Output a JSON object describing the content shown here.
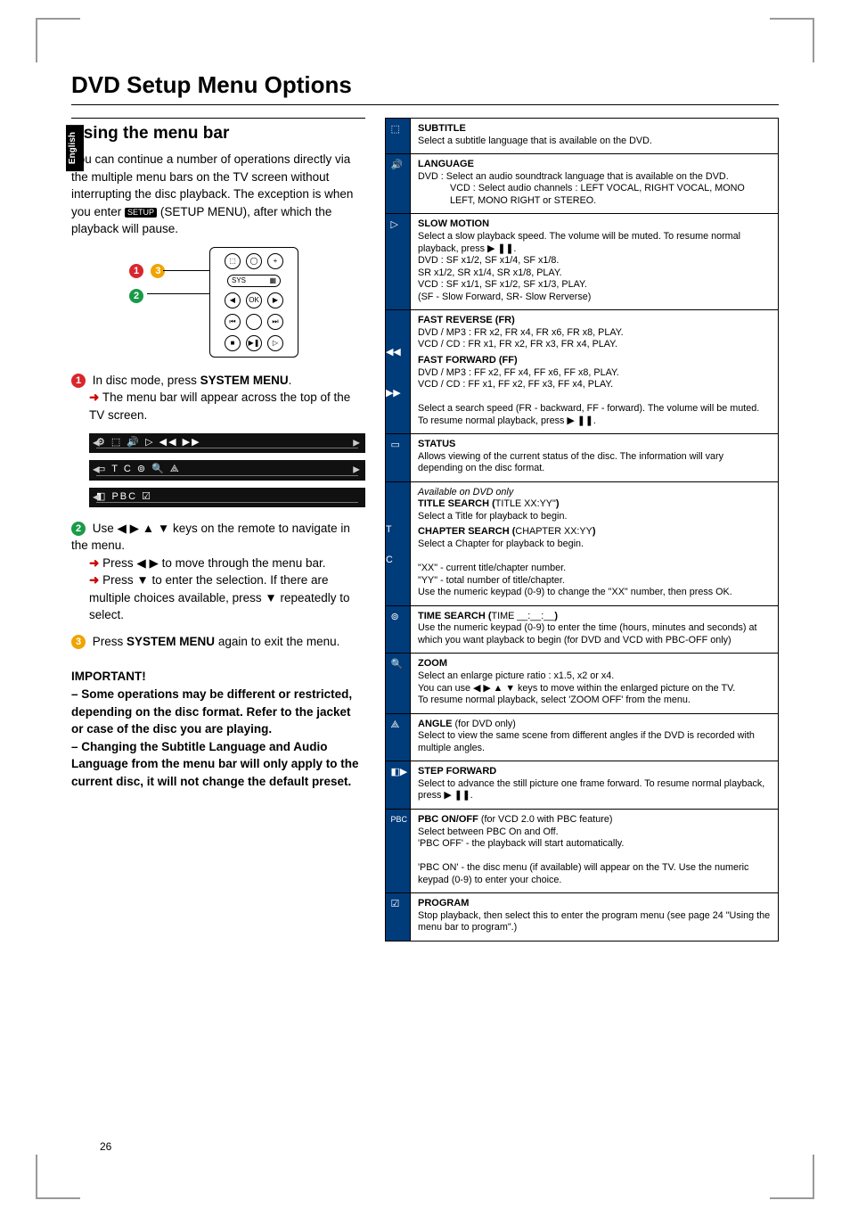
{
  "page": {
    "number": "26",
    "language_tab": "English",
    "title": "DVD Setup Menu Options"
  },
  "left": {
    "section_title": "Using the menu bar",
    "intro_a": "You can continue a number of operations directly via the multiple menu bars on the TV screen without interrupting the disc playback.  The exception is when you enter ",
    "intro_chip": "SETUP",
    "intro_b": " (SETUP MENU), after which the playback will pause.",
    "remote_callouts": {
      "left_top": "1",
      "left_top2": "3",
      "left_mid": "2"
    },
    "steps": [
      {
        "badge": "1",
        "badge_class": "num-1",
        "text_a": "In disc mode, press ",
        "strong_a": "SYSTEM MENU",
        "text_b": ".",
        "sub": "The menu bar will appear across the top of the TV screen."
      },
      {
        "badge": "2",
        "badge_class": "num-2",
        "text_a": "Use ◀ ▶ ▲ ▼ keys on the remote to navigate in the menu.",
        "strong_a": "",
        "text_b": "",
        "sub": "",
        "subs": [
          "Press ◀ ▶ to move through the menu bar.",
          "Press ▼ to enter the selection.  If there are multiple choices available, press ▼ repeatedly to select."
        ]
      },
      {
        "badge": "3",
        "badge_class": "num-3",
        "text_a": "Press ",
        "strong_a": "SYSTEM MENU",
        "text_b": " again to exit the menu.",
        "sub": ""
      }
    ],
    "important_title": "IMPORTANT!",
    "important_body": "– Some operations may be different or restricted, depending on the disc format. Refer to the jacket or case of the disc you are playing.\n– Changing the Subtitle Language and Audio Language from the menu bar will only apply to the current disc, it will not change the default preset."
  },
  "features": [
    {
      "icon": "subtitle",
      "title": "SUBTITLE",
      "body": "Select a subtitle language that is available on the DVD."
    },
    {
      "icon": "language",
      "title": "LANGUAGE",
      "body": "DVD : Select an audio soundtrack language that is available on the DVD.\nVCD : Select audio channels : LEFT VOCAL, RIGHT VOCAL, MONO LEFT, MONO RIGHT or STEREO."
    },
    {
      "icon": "slow",
      "title": "SLOW MOTION",
      "body": "Select a slow playback speed. The volume will be muted.  To resume normal playback, press  ▶ ❚❚.\nDVD :  SF x1/2, SF x1/4, SF x1/8.\n          SR x1/2, SR x1/4, SR x1/8, PLAY.\nVCD :  SF x1/1, SF x1/2, SF x1/3, PLAY.\n          (SF - Slow Forward, SR- Slow Rerverse)"
    },
    {
      "icon": "fr",
      "title": "FAST REVERSE (FR)",
      "body": "DVD / MP3 : FR x2, FR x4, FR x6, FR x8, PLAY.\nVCD / CD : FR x1, FR x2, FR x3, FR x4, PLAY.",
      "title2": "FAST FORWARD (FF)",
      "body2": "DVD / MP3 : FF x2, FF x4, FF x6, FF x8, PLAY.\nVCD / CD : FF x1, FF x2, FF x3, FF x4, PLAY.\n\nSelect a search speed (FR - backward, FF - forward). The volume will be muted.  To resume normal playback, press  ▶ ❚❚."
    },
    {
      "icon": "status",
      "title": "STATUS",
      "body": "Allows viewing of the current status of the disc. The information will vary depending on the disc format."
    },
    {
      "icon": "title",
      "pre": "Available on DVD only",
      "title": "TITLE SEARCH (",
      "title_code": "TITLE XX:YY\"",
      "title_end": ")",
      "body": "Select a Title for playback to begin.",
      "title2": "CHAPTER SEARCH (",
      "title2_code": "CHAPTER XX:YY",
      "title2_end": ")",
      "body2": "Select a Chapter for playback to begin.\n\n\"XX\" - current title/chapter number.\n\"YY\" - total number of title/chapter.\nUse the numeric keypad (0-9) to change the \"XX\" number, then press OK."
    },
    {
      "icon": "time",
      "title": "TIME SEARCH (",
      "title_code": "TIME __:__:__",
      "title_end": ")",
      "body": "Use the numeric keypad (0-9) to enter the time (hours, minutes and seconds) at which you want playback to begin (for DVD and VCD with PBC-OFF only)"
    },
    {
      "icon": "zoom",
      "title": "ZOOM",
      "body": "Select an enlarge picture ratio : x1.5, x2 or x4.\nYou can use ◀ ▶ ▲ ▼ keys to move within the enlarged picture on the TV.\nTo resume normal playback, select 'ZOOM OFF' from the menu."
    },
    {
      "icon": "angle",
      "title": "ANGLE",
      "title_note": " (for DVD only)",
      "body": "Select to view the same scene from different angles if the DVD is recorded with multiple angles."
    },
    {
      "icon": "step",
      "title": "STEP FORWARD",
      "body": "Select to advance the still picture one frame forward. To resume normal playback, press  ▶ ❚❚."
    },
    {
      "icon": "pbc",
      "title": "PBC ON/OFF",
      "title_note": " (for VCD 2.0 with PBC feature)",
      "body": "Select between PBC On and Off.\n'PBC OFF' - the playback will start automatically.\n\n'PBC ON' - the disc menu (if available) will appear on the TV. Use the numeric keypad (0-9) to enter your choice."
    },
    {
      "icon": "program",
      "title": "PROGRAM",
      "body": "Stop playback, then select this to enter the program menu (see page 24 \"Using the menu bar to program\".)"
    }
  ],
  "menubar_rows": {
    "r1": "⚙   ⬚   🔊   ▷   ◀◀   ▶▶",
    "r2": "▭   T   C   ⊚   🔍   ⟁",
    "r3": "◧   PBC   ☑"
  }
}
